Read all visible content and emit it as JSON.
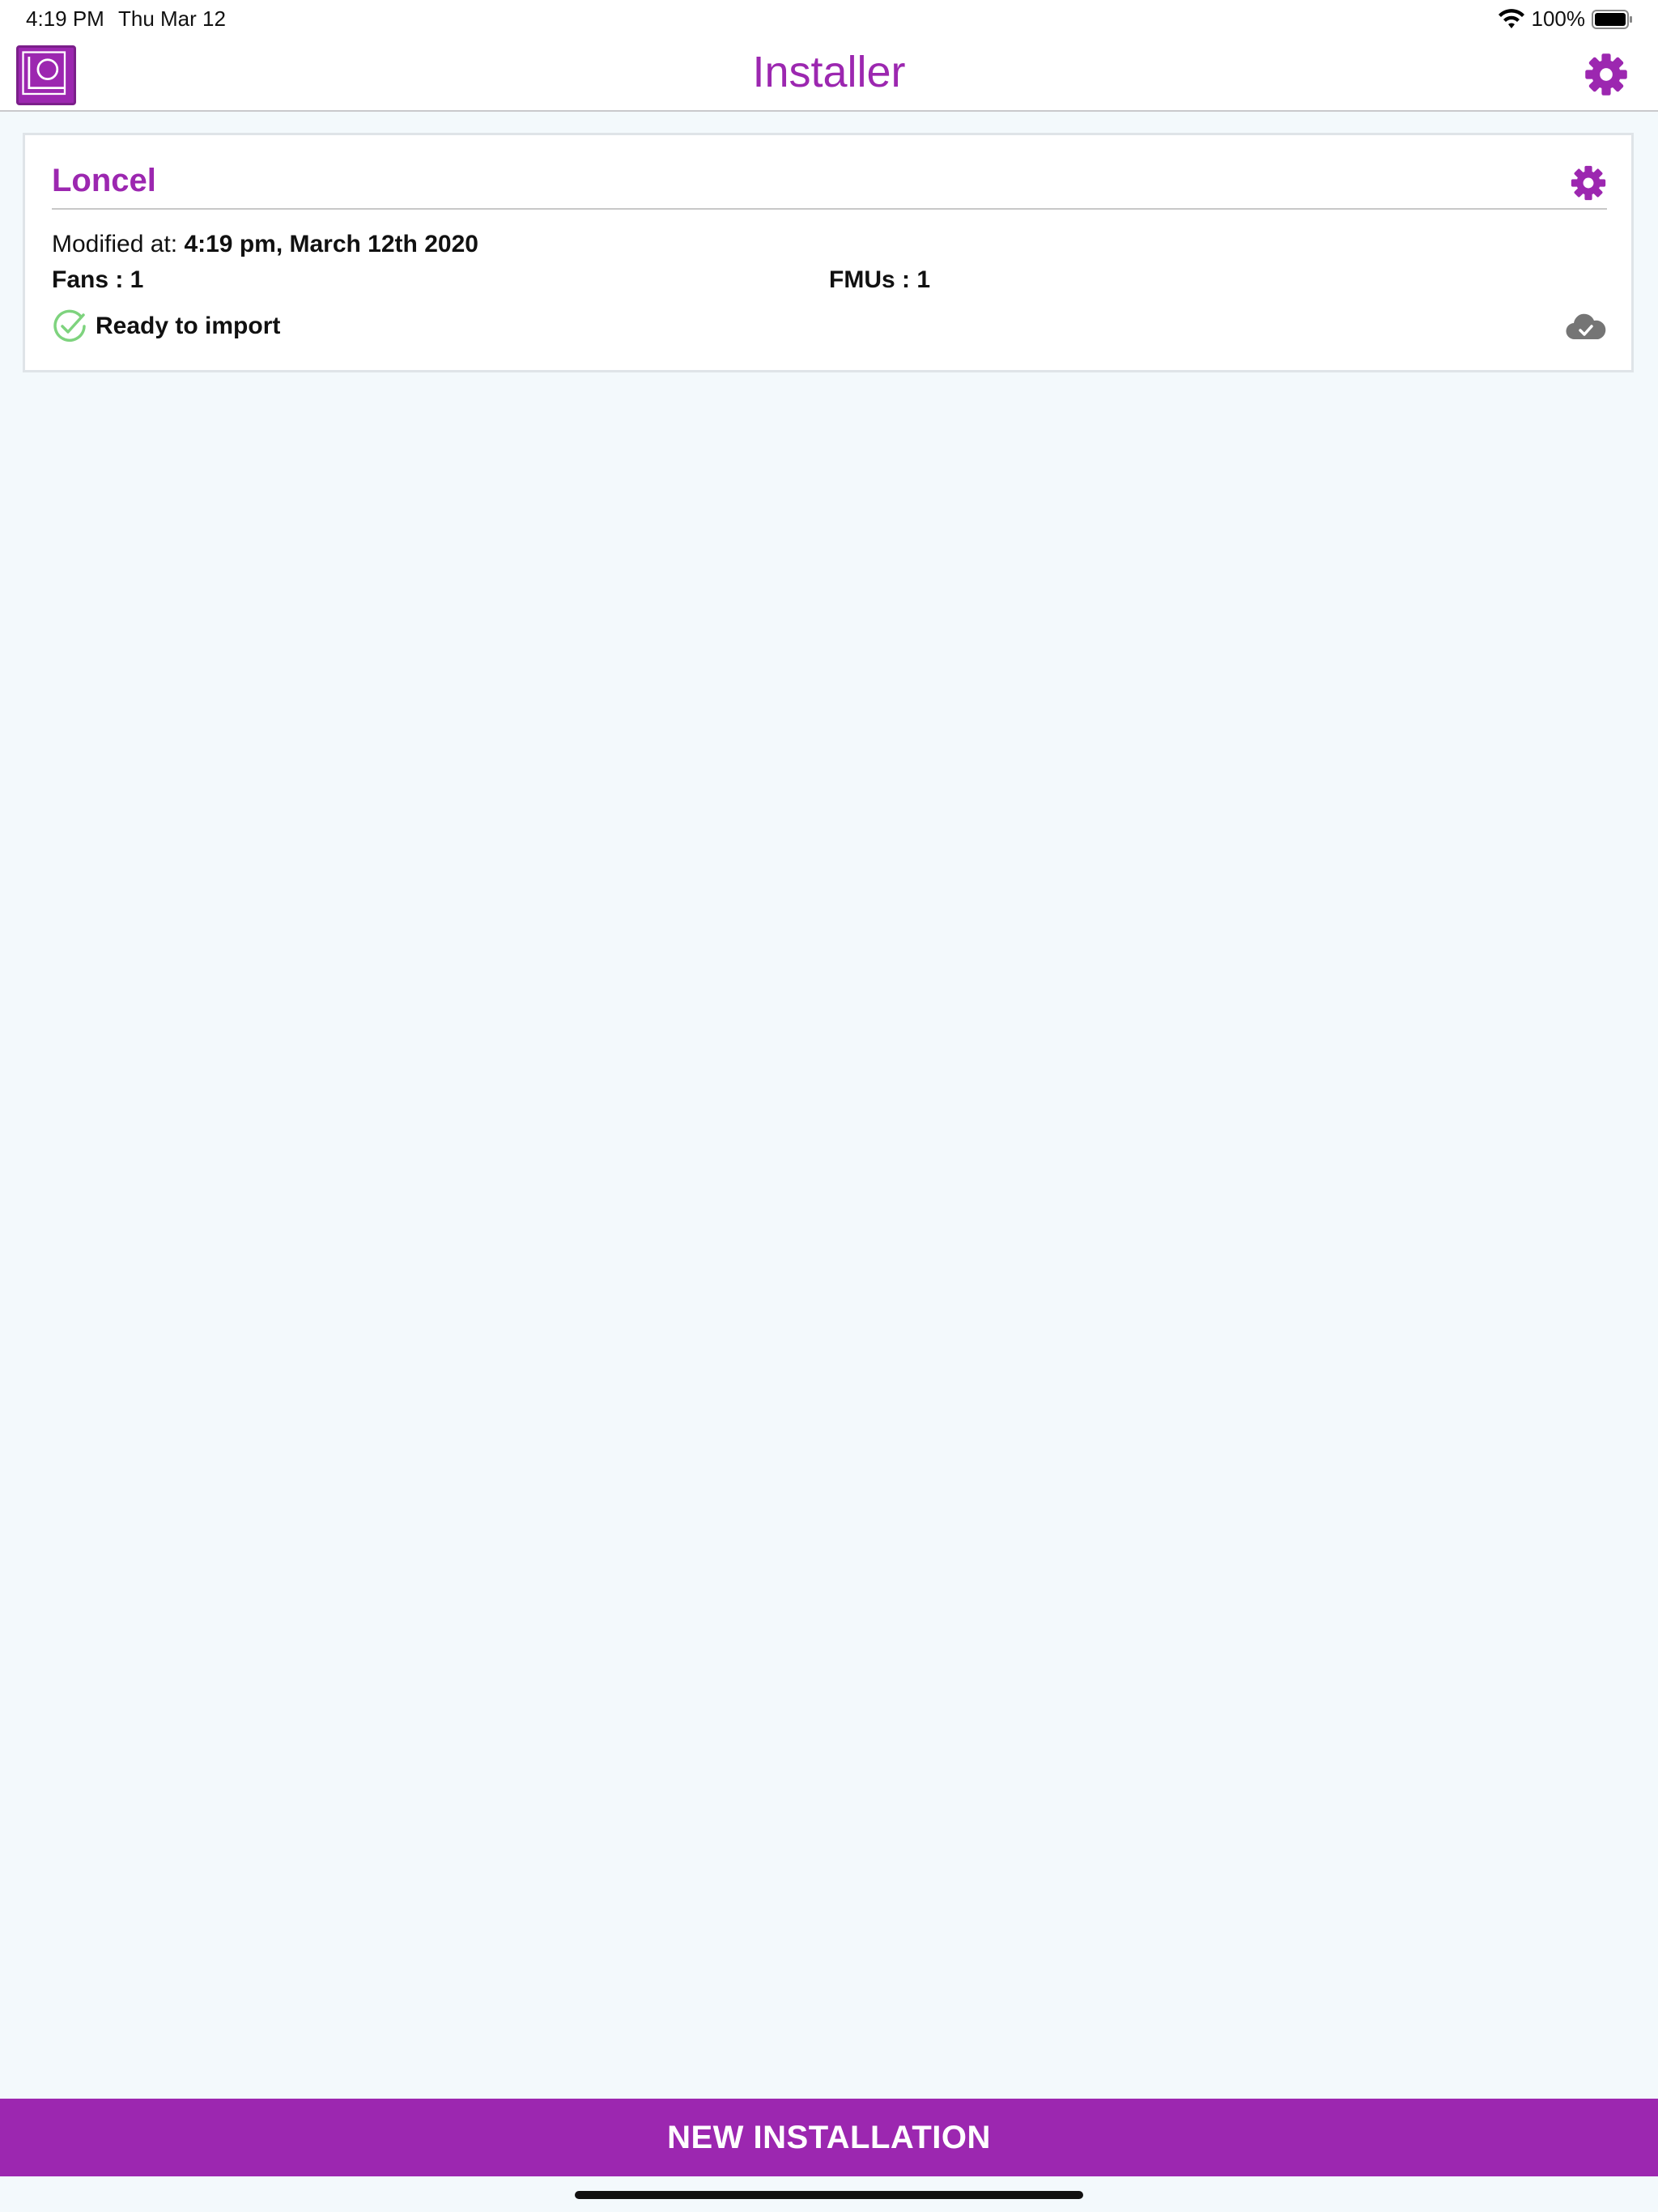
{
  "status_bar": {
    "time": "4:19 PM",
    "date": "Thu Mar 12",
    "battery": "100%",
    "icons": [
      "wifi-icon",
      "battery-icon"
    ]
  },
  "nav": {
    "title": "Installer",
    "icons": [
      "app-logo-icon",
      "gear-icon"
    ]
  },
  "installations": [
    {
      "name": "Loncel",
      "modified_label": "Modified at:",
      "modified_value": "4:19 pm, March 12th 2020",
      "fans": "Fans : 1",
      "fmus": "FMUs : 1",
      "status": "Ready to import",
      "icons": [
        "gear-icon",
        "check-circle-icon",
        "cloud-check-icon"
      ]
    }
  ],
  "footer": {
    "new_installation_label": "NEW INSTALLATION"
  },
  "colors": {
    "accent": "#9c27b0",
    "background": "#f3f9fc",
    "success": "#7ed37e",
    "cloud": "#757575"
  }
}
